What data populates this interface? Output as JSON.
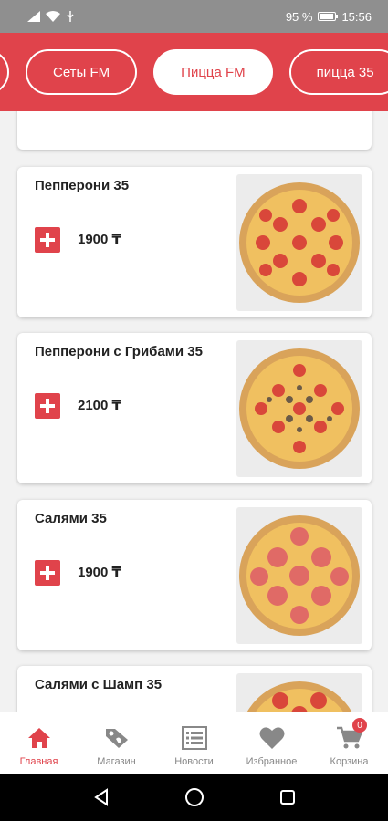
{
  "status_bar": {
    "battery": "95 %",
    "time": "15:56"
  },
  "categories": [
    {
      "label": ""
    },
    {
      "label": "Сеты FM"
    },
    {
      "label": "Пицца FM",
      "active": true
    },
    {
      "label": "пицца 35"
    }
  ],
  "products": [
    {
      "name": "Пепперони 35",
      "price": "1900 ₸",
      "image": "pepperoni-pizza"
    },
    {
      "name": "Пепперони с Грибами 35",
      "price": "2100 ₸",
      "image": "pepperoni-mushroom-pizza"
    },
    {
      "name": "Салями 35",
      "price": "1900 ₸",
      "image": "salami-pizza"
    },
    {
      "name": "Салями с Шамп 35",
      "price": "",
      "image": "salami-mushroom-pizza"
    }
  ],
  "bottom_nav": [
    {
      "label": "Главная",
      "icon": "home-icon",
      "active": true
    },
    {
      "label": "Магазин",
      "icon": "tag-icon"
    },
    {
      "label": "Новости",
      "icon": "list-icon"
    },
    {
      "label": "Избранное",
      "icon": "heart-icon"
    },
    {
      "label": "Корзина",
      "icon": "cart-icon",
      "badge": "0"
    }
  ],
  "colors": {
    "accent": "#e0434b",
    "status_bar": "#8f8f8f",
    "nav_inactive": "#888888"
  }
}
